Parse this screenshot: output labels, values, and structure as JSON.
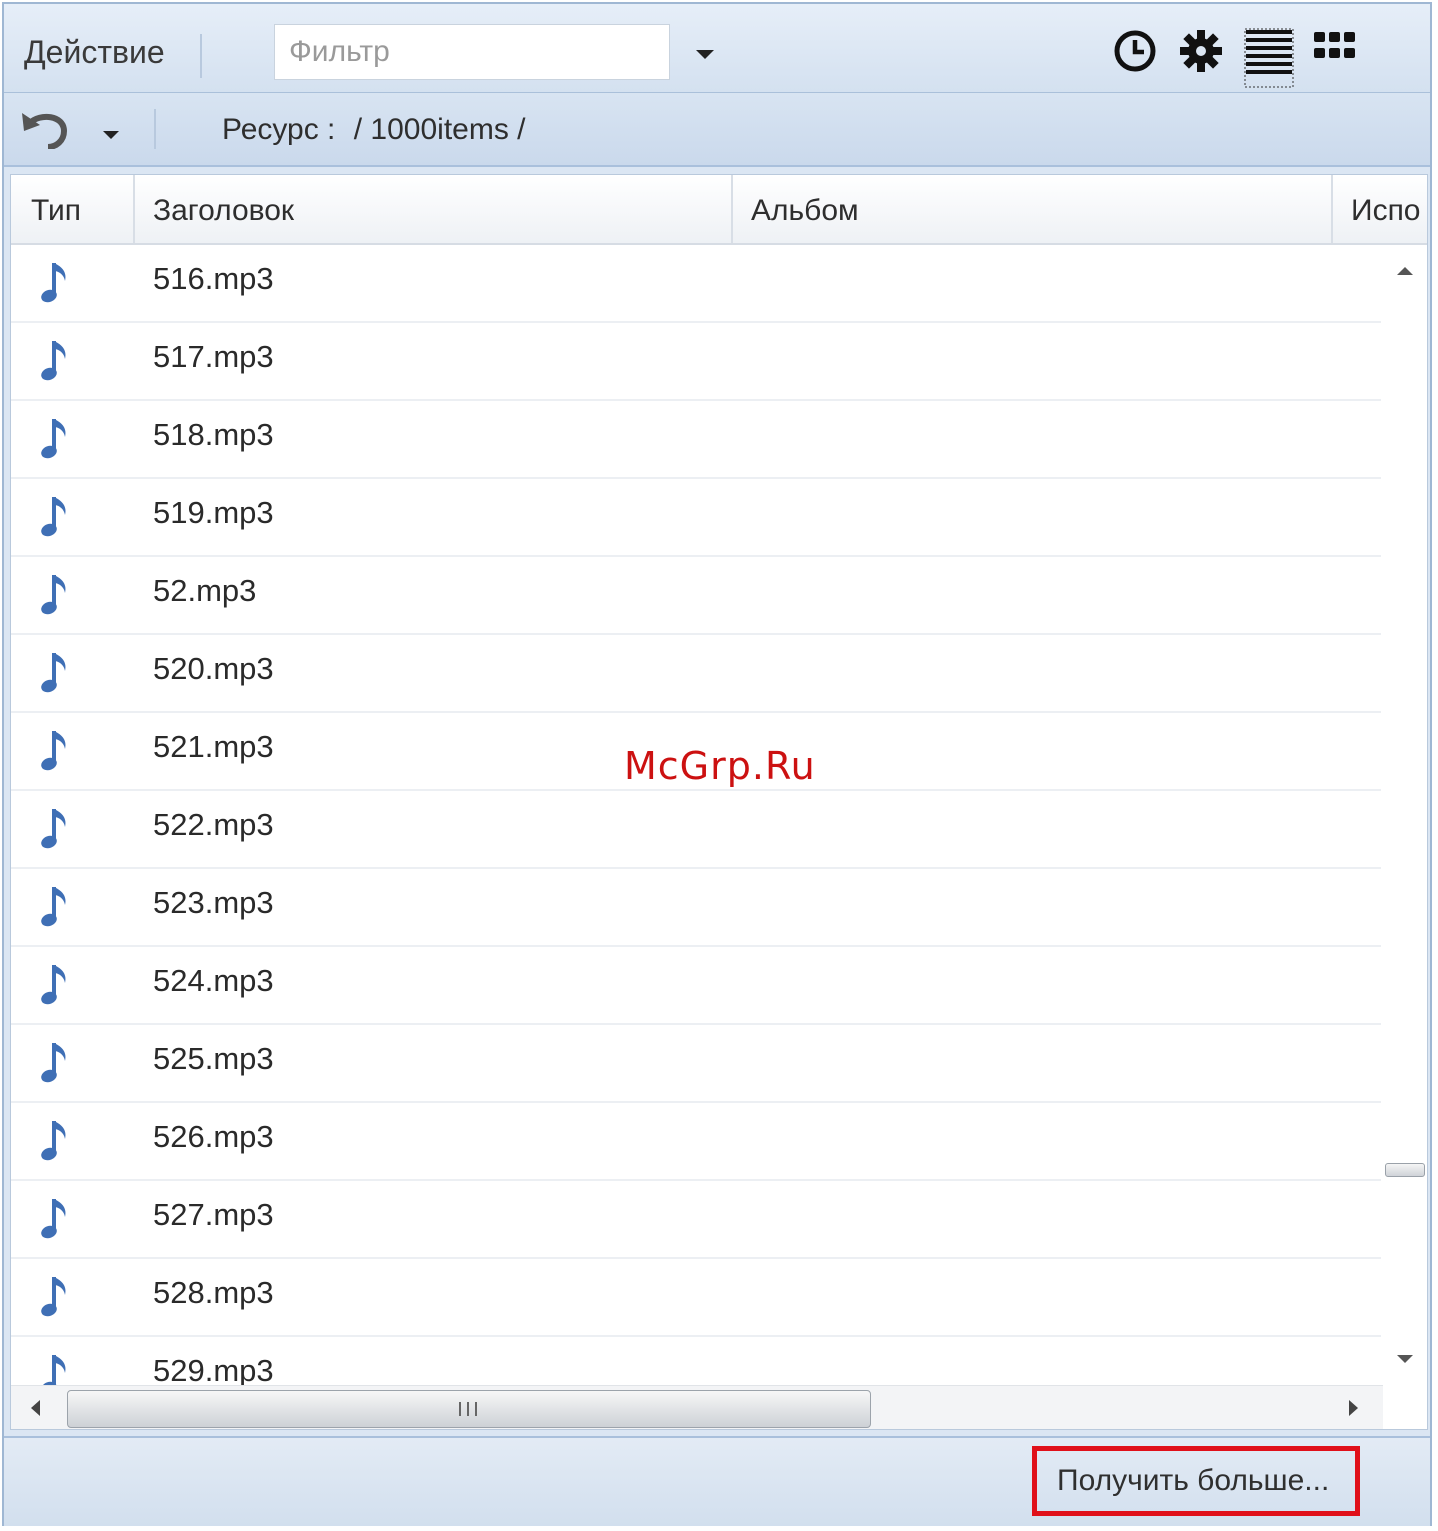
{
  "toolbar": {
    "action_label": "Действие",
    "filter_placeholder": "Фильтр",
    "icons": [
      "clock-icon",
      "gear-icon",
      "list-view-icon",
      "grid-view-icon"
    ]
  },
  "breadcrumb": {
    "label": "Ресурс :",
    "path": "/ 1000items /"
  },
  "grid": {
    "columns": [
      "Тип",
      "Заголовок",
      "Альбом",
      "Испо"
    ],
    "rows": [
      {
        "type_icon": "music-note-icon",
        "title": "516.mp3"
      },
      {
        "type_icon": "music-note-icon",
        "title": "517.mp3"
      },
      {
        "type_icon": "music-note-icon",
        "title": "518.mp3"
      },
      {
        "type_icon": "music-note-icon",
        "title": "519.mp3"
      },
      {
        "type_icon": "music-note-icon",
        "title": "52.mp3"
      },
      {
        "type_icon": "music-note-icon",
        "title": "520.mp3"
      },
      {
        "type_icon": "music-note-icon",
        "title": "521.mp3"
      },
      {
        "type_icon": "music-note-icon",
        "title": "522.mp3"
      },
      {
        "type_icon": "music-note-icon",
        "title": "523.mp3"
      },
      {
        "type_icon": "music-note-icon",
        "title": "524.mp3"
      },
      {
        "type_icon": "music-note-icon",
        "title": "525.mp3"
      },
      {
        "type_icon": "music-note-icon",
        "title": "526.mp3"
      },
      {
        "type_icon": "music-note-icon",
        "title": "527.mp3"
      },
      {
        "type_icon": "music-note-icon",
        "title": "528.mp3"
      },
      {
        "type_icon": "music-note-icon",
        "title": "529.mp3"
      }
    ]
  },
  "footer": {
    "more_label": "Получить больше..."
  },
  "watermark": "McGrp.Ru",
  "colors": {
    "accent_highlight": "#e0101a",
    "note_icon": "#3f6fb5",
    "toolbar_bg": "#d4e1f0"
  }
}
